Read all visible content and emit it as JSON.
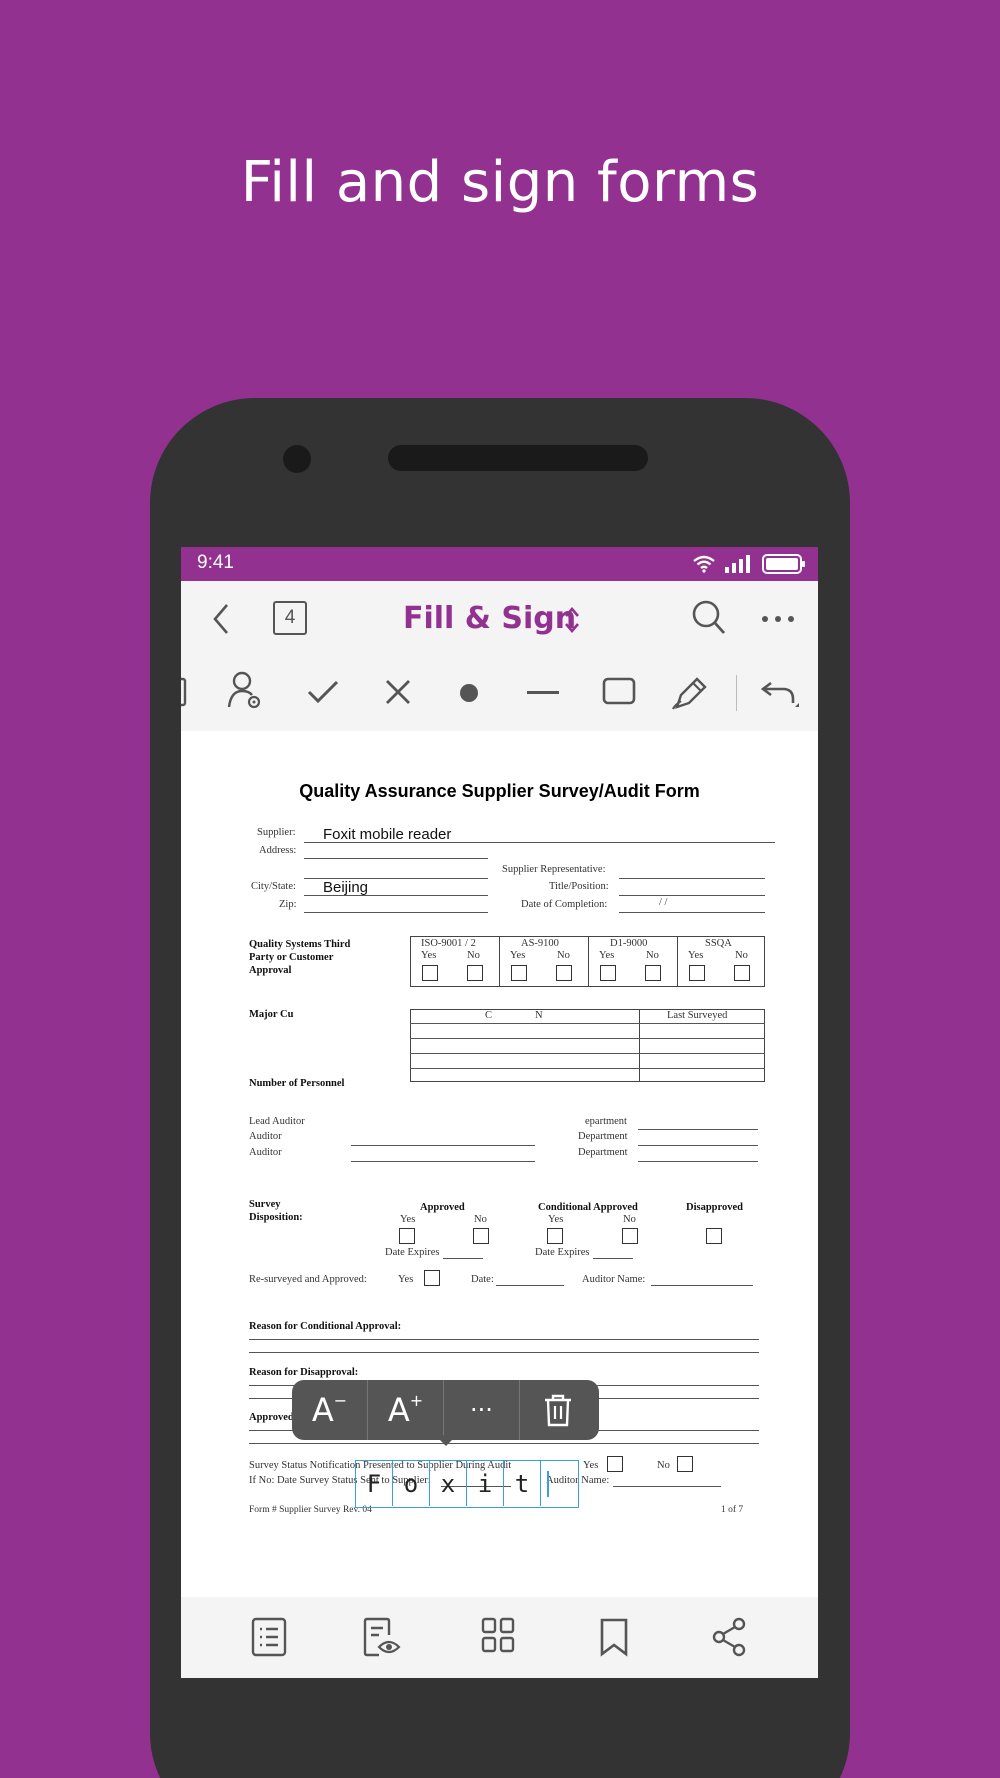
{
  "headline": "Fill and sign forms",
  "status": {
    "time": "9:41"
  },
  "titlebar": {
    "page_count": "4",
    "title": "Fill & Sign"
  },
  "toolbar": {
    "tools": [
      "text-icon",
      "profile-icon",
      "check-icon",
      "cross-icon",
      "dot-icon",
      "line-icon",
      "rectangle-icon",
      "signature-icon",
      "undo-icon"
    ]
  },
  "form": {
    "title": "Quality Assurance Supplier Survey/Audit Form",
    "supplier_label": "Supplier:",
    "supplier_value": "Foxit mobile reader",
    "address_label": "Address:",
    "city_label": "City/State:",
    "city_value": "Beijing",
    "zip_label": "Zip:",
    "supplier_rep_label": "Supplier Representative:",
    "title_position_label": "Title/Position:",
    "date_completion_label": "Date of Completion:",
    "date_slashes": "/          /",
    "qs_label": "Quality Systems Third Party or Customer Approval",
    "qs_columns": [
      "ISO-9001 / 2",
      "AS-9100",
      "D1-9000",
      "SSQA"
    ],
    "yes": "Yes",
    "no": "No",
    "major_customers_label": "Major Cu",
    "customer_col_partial": "C",
    "customer_col_partial2": "N",
    "last_surveyed": "Last Surveyed",
    "num_personnel": "Number of Personnel",
    "lead_auditor": "Lead Auditor",
    "auditor": "Auditor",
    "auditor2": "Auditor",
    "department_partial": "epartment",
    "department": "Department",
    "department2": "Department",
    "survey_disposition": "Survey Disposition:",
    "approved": "Approved",
    "conditional_approved": "Conditional Approved",
    "disapproved": "Disapproved",
    "date_expires": "Date Expires",
    "resurveyed": "Re-surveyed and Approved:",
    "date_label": "Date:",
    "auditor_name": "Auditor Name:",
    "reason_conditional": "Reason for Conditional Approval:",
    "reason_disapproval": "Reason for Disapproval:",
    "approved_manufacture": "Approved to Manufacture or Service Only:",
    "status_notification": "Survey Status Notification  Presented to Supplier  During Audit",
    "if_no": "If No: Date Survey Status Sent to Supplier:",
    "footer_left": "Form # Supplier Survey Rev. 04",
    "footer_right": "1 of 7"
  },
  "popup": {
    "decrease": "A",
    "increase": "A",
    "more": "···"
  },
  "comb": [
    "F",
    "o",
    "x",
    "i",
    "t",
    ""
  ],
  "bottom_nav": [
    "list-icon",
    "review-icon",
    "grid-icon",
    "bookmark-icon",
    "share-icon"
  ]
}
